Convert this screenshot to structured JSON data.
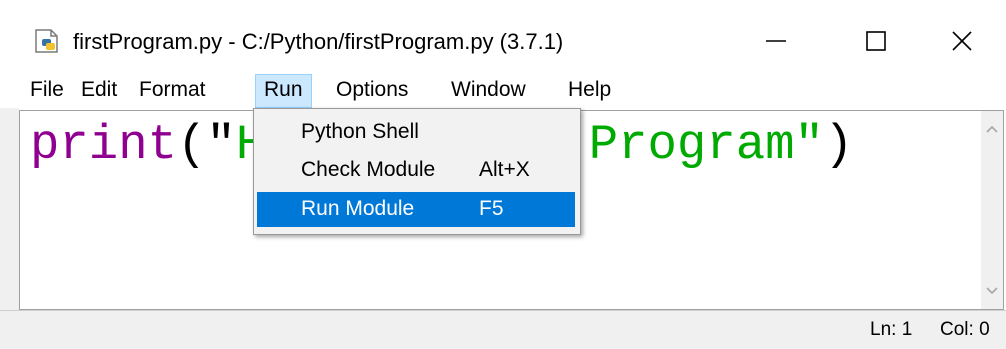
{
  "window": {
    "title": "firstProgram.py - C:/Python/firstProgram.py (3.7.1)",
    "app_icon": "python-file-icon",
    "controls": [
      "minimize-icon",
      "maximize-icon",
      "close-icon"
    ]
  },
  "menubar": {
    "items": [
      {
        "label": "File"
      },
      {
        "label": "Edit"
      },
      {
        "label": "Format"
      },
      {
        "label": "Run"
      },
      {
        "label": "Options"
      },
      {
        "label": "Window"
      },
      {
        "label": "Help"
      }
    ],
    "active": "Run"
  },
  "editor": {
    "code_tokens": [
      {
        "text": "print",
        "kind": "builtin"
      },
      {
        "text": "(\"",
        "kind": "punct"
      },
      {
        "text": "Hello World Program\"",
        "kind": "string"
      },
      {
        "text": ")",
        "kind": "punct"
      }
    ],
    "colors": {
      "builtin": "#900090",
      "string": "#00aa00",
      "punct": "#000000"
    }
  },
  "run_menu": {
    "items": [
      {
        "label": "Python Shell",
        "shortcut": ""
      },
      {
        "label": "Check Module",
        "shortcut": "Alt+X"
      },
      {
        "label": "Run Module",
        "shortcut": "F5",
        "highlighted": true
      }
    ],
    "highlight_color": "#0078d7"
  },
  "statusbar": {
    "line": "Ln: 1",
    "col": "Col: 0"
  }
}
